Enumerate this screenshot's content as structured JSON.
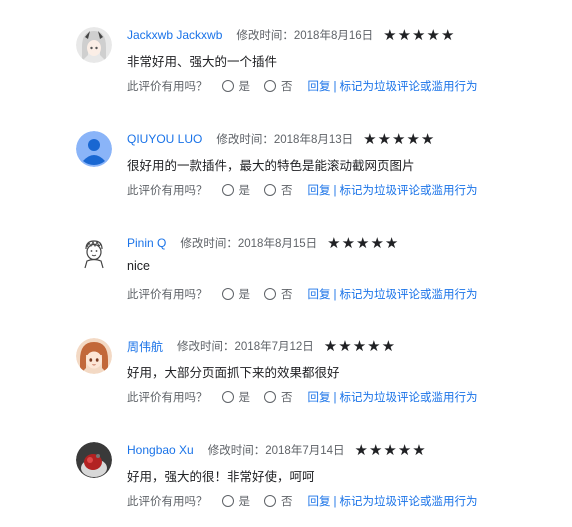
{
  "reviews": [
    {
      "author": "Jackxwb Jackxwb",
      "modified": "修改时间：2018年8月16日",
      "stars": "★★★★★",
      "rating": 5,
      "text": "非常好用、强大的一个插件",
      "avatar": "anime-girl-avatar"
    },
    {
      "author": "QIUYOU LUO",
      "modified": "修改时间：2018年8月13日",
      "stars": "★★★★★",
      "rating": 5,
      "text": "很好用的一款插件，最大的特色是能滚动截网页图片",
      "avatar": "default-person-avatar"
    },
    {
      "author": "Pinin Q",
      "modified": "修改时间：2018年8月15日",
      "stars": "★★★★★",
      "rating": 5,
      "text": "nice",
      "avatar": "sketch-boy-avatar"
    },
    {
      "author": "周伟航",
      "modified": "修改时间：2018年7月12日",
      "stars": "★★★★★",
      "rating": 5,
      "text": "好用，大部分页面抓下来的效果都很好",
      "avatar": "anime-girl-avatar"
    },
    {
      "author": "Hongbao Xu",
      "modified": "修改时间：2018年7月14日",
      "stars": "★★★★★",
      "rating": 5,
      "text": "好用，强大的很！非常好使，呵呵",
      "avatar": "photo-avatar"
    }
  ],
  "helpful": {
    "question": "此评价有用吗？",
    "yes": "是",
    "no": "否",
    "reply": "回复",
    "separator": "|",
    "report": "标记为垃圾评论或滥用行为"
  },
  "colors": {
    "link": "#1a73e8",
    "meta": "#5f6368",
    "text": "#202124"
  }
}
